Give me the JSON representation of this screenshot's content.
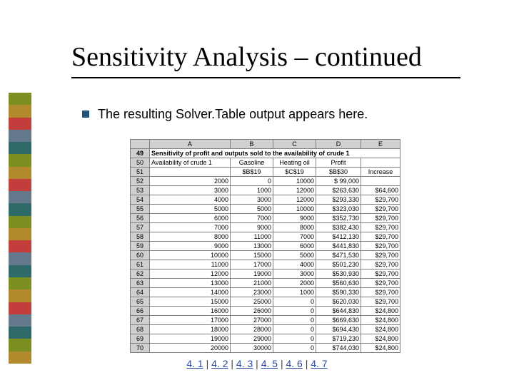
{
  "title": "Sensitivity Analysis – continued",
  "bullet": "The resulting Solver.Table output appears here.",
  "stripe_colors": [
    "#7a8f1f",
    "#b28a2e",
    "#c43d3d",
    "#647a8c",
    "#2e6a6a",
    "#7a8f1f",
    "#b28a2e",
    "#c43d3d",
    "#647a8c",
    "#2e6a6a",
    "#7a8f1f",
    "#b28a2e",
    "#c43d3d",
    "#647a8c",
    "#2e6a6a",
    "#7a8f1f",
    "#b28a2e",
    "#c43d3d",
    "#647a8c",
    "#2e6a6a",
    "#7a8f1f",
    "#b28a2e"
  ],
  "sheet": {
    "col_headers": [
      "",
      "A",
      "B",
      "C",
      "D",
      "E"
    ],
    "caption_row": {
      "num": "49",
      "text": "Sensitivity of profit and outputs sold to the availability of crude 1"
    },
    "header_labels_row": {
      "num": "50",
      "a": "Availability of crude 1",
      "b": "Gasoline",
      "c": "Heating oil",
      "d": "Profit",
      "e": ""
    },
    "refs_row": {
      "num": "51",
      "a": "",
      "b": "$B$19",
      "c": "$C$19",
      "d": "$B$30",
      "e": "Increase"
    },
    "data_rows": [
      {
        "num": "52",
        "a": "2000",
        "b": "0",
        "c": "10000",
        "d": "$  99,000",
        "e": ""
      },
      {
        "num": "53",
        "a": "3000",
        "b": "1000",
        "c": "12000",
        "d": "$263,630",
        "e": "$64,600"
      },
      {
        "num": "54",
        "a": "4000",
        "b": "3000",
        "c": "12000",
        "d": "$293,330",
        "e": "$29,700"
      },
      {
        "num": "55",
        "a": "5000",
        "b": "5000",
        "c": "10000",
        "d": "$323,030",
        "e": "$29,700"
      },
      {
        "num": "56",
        "a": "6000",
        "b": "7000",
        "c": "9000",
        "d": "$352,730",
        "e": "$29,700"
      },
      {
        "num": "57",
        "a": "7000",
        "b": "9000",
        "c": "8000",
        "d": "$382,430",
        "e": "$29,700"
      },
      {
        "num": "58",
        "a": "8000",
        "b": "11000",
        "c": "7000",
        "d": "$412,130",
        "e": "$29,700"
      },
      {
        "num": "59",
        "a": "9000",
        "b": "13000",
        "c": "6000",
        "d": "$441,830",
        "e": "$29,700"
      },
      {
        "num": "60",
        "a": "10000",
        "b": "15000",
        "c": "5000",
        "d": "$471,530",
        "e": "$29,700"
      },
      {
        "num": "61",
        "a": "11000",
        "b": "17000",
        "c": "4000",
        "d": "$501,230",
        "e": "$29,700"
      },
      {
        "num": "62",
        "a": "12000",
        "b": "19000",
        "c": "3000",
        "d": "$530,930",
        "e": "$29,700"
      },
      {
        "num": "63",
        "a": "13000",
        "b": "21000",
        "c": "2000",
        "d": "$560,630",
        "e": "$29,700"
      },
      {
        "num": "64",
        "a": "14000",
        "b": "23000",
        "c": "1000",
        "d": "$590,330",
        "e": "$29,700"
      },
      {
        "num": "65",
        "a": "15000",
        "b": "25000",
        "c": "0",
        "d": "$620,030",
        "e": "$29,700"
      },
      {
        "num": "66",
        "a": "16000",
        "b": "26000",
        "c": "0",
        "d": "$644,830",
        "e": "$24,800"
      },
      {
        "num": "67",
        "a": "17000",
        "b": "27000",
        "c": "0",
        "d": "$669,630",
        "e": "$24,800"
      },
      {
        "num": "68",
        "a": "18000",
        "b": "28000",
        "c": "0",
        "d": "$694,430",
        "e": "$24,800"
      },
      {
        "num": "69",
        "a": "19000",
        "b": "29000",
        "c": "0",
        "d": "$719,230",
        "e": "$24,800"
      },
      {
        "num": "70",
        "a": "20000",
        "b": "30000",
        "c": "0",
        "d": "$744,030",
        "e": "$24,800"
      }
    ]
  },
  "links": {
    "sep": " | ",
    "items": [
      "4. 1",
      "4. 2",
      "4. 3",
      "4. 5",
      "4. 6",
      "4. 7"
    ]
  },
  "chart_data": {
    "type": "table",
    "title": "Sensitivity of profit and outputs sold to the availability of crude 1",
    "columns": [
      "Availability of crude 1",
      "Gasoline",
      "Heating oil",
      "Profit",
      "Increase"
    ],
    "refs": [
      "$B$19",
      "$C$19",
      "$B$30"
    ],
    "rows": [
      [
        2000,
        0,
        10000,
        99000,
        null
      ],
      [
        3000,
        1000,
        12000,
        263630,
        64600
      ],
      [
        4000,
        3000,
        12000,
        293330,
        29700
      ],
      [
        5000,
        5000,
        10000,
        323030,
        29700
      ],
      [
        6000,
        7000,
        9000,
        352730,
        29700
      ],
      [
        7000,
        9000,
        8000,
        382430,
        29700
      ],
      [
        8000,
        11000,
        7000,
        412130,
        29700
      ],
      [
        9000,
        13000,
        6000,
        441830,
        29700
      ],
      [
        10000,
        15000,
        5000,
        471530,
        29700
      ],
      [
        11000,
        17000,
        4000,
        501230,
        29700
      ],
      [
        12000,
        19000,
        3000,
        530930,
        29700
      ],
      [
        13000,
        21000,
        2000,
        560630,
        29700
      ],
      [
        14000,
        23000,
        1000,
        590330,
        29700
      ],
      [
        15000,
        25000,
        0,
        620030,
        29700
      ],
      [
        16000,
        26000,
        0,
        644830,
        24800
      ],
      [
        17000,
        27000,
        0,
        669630,
        24800
      ],
      [
        18000,
        28000,
        0,
        694430,
        24800
      ],
      [
        19000,
        29000,
        0,
        719230,
        24800
      ],
      [
        20000,
        30000,
        0,
        744030,
        24800
      ]
    ]
  }
}
